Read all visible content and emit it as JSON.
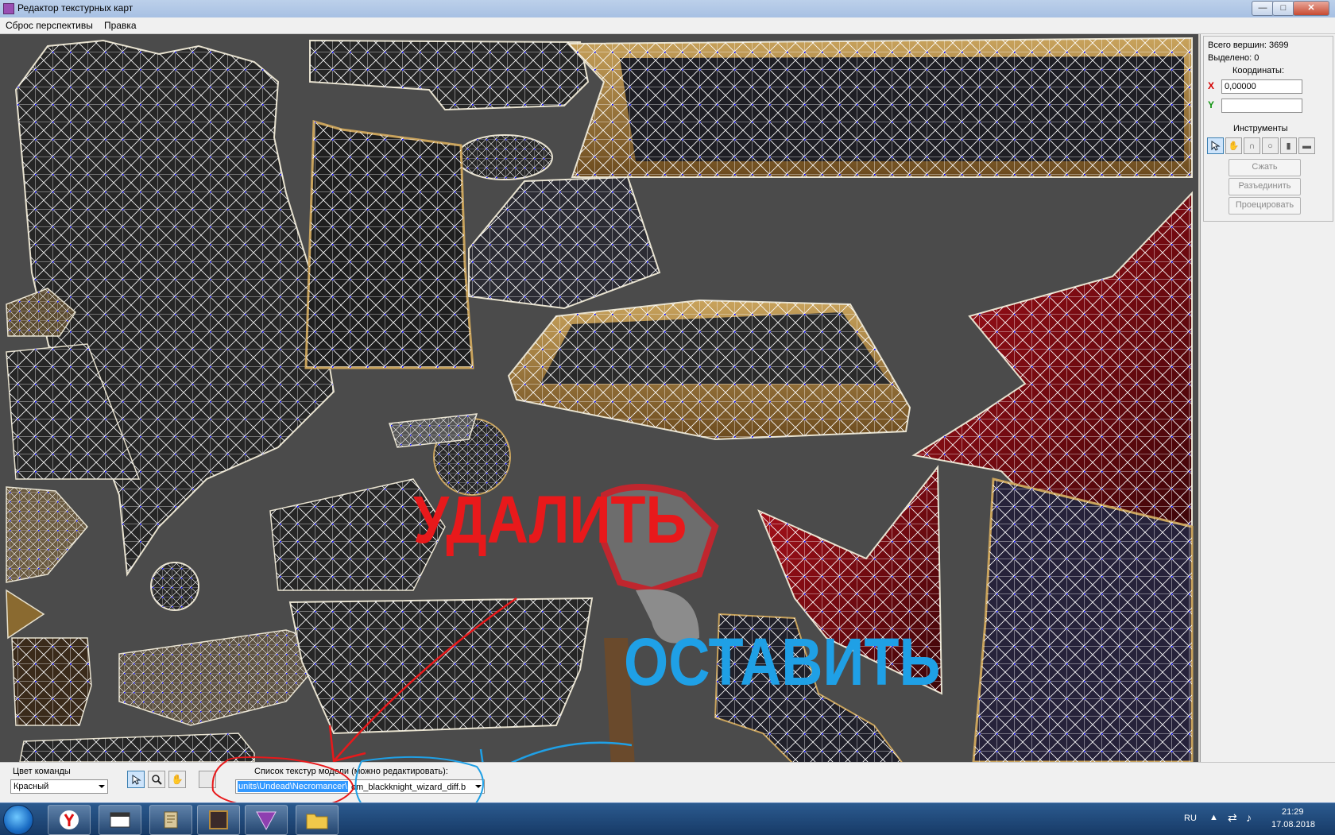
{
  "window": {
    "title": "Редактор текстурных карт",
    "buttons": {
      "minimize": "—",
      "maximize": "□",
      "close": "✕"
    }
  },
  "menu": {
    "items": [
      "Сброс перспективы",
      "Правка"
    ]
  },
  "canvas": {
    "annotations": {
      "delete_label": "УДАЛИТЬ",
      "keep_label": "ОСТАВИТЬ",
      "delete_color": "#e8191b",
      "keep_color": "#1fa0e6"
    }
  },
  "panel": {
    "total_vertices_label": "Всего вершин: 3699",
    "selected_label": "Выделено: 0",
    "coordinates_label": "Координаты:",
    "x_axis": "X",
    "y_axis": "Y",
    "x_value": "0,00000",
    "y_value": "",
    "tools_label": "Инструменты",
    "tools": [
      "select-icon",
      "hand-icon",
      "magnet-icon",
      "circle-icon",
      "vertical-bar-icon",
      "horizontal-bar-icon"
    ],
    "compress_button": "Сжать",
    "split_button": "Разъединить",
    "project_button": "Проецировать"
  },
  "bottom": {
    "team_color_label": "Цвет команды",
    "team_color_value": "Красный",
    "texture_list_label": "Список текстур модели (можно редактировать):",
    "texture_path_selected": "units\\Undead\\Necromancer\\",
    "texture_path_rest": "om_blackknight_wizard_diff.b"
  },
  "taskbar": {
    "language": "RU",
    "time": "21:29",
    "date": "17.08.2018"
  }
}
